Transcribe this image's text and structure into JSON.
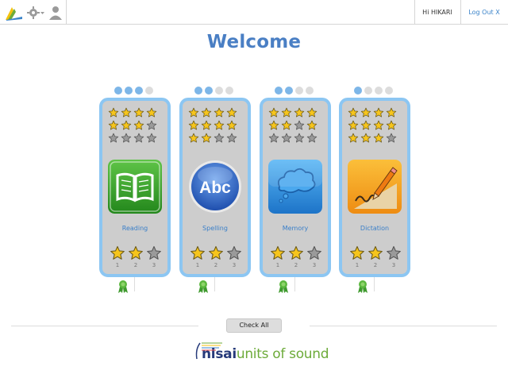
{
  "header": {
    "greeting": "Hi HIKARI",
    "logout_label": "Log Out X"
  },
  "page": {
    "title": "Welcome"
  },
  "units": [
    {
      "label": "Reading",
      "progress_dots_filled": 3,
      "progress_dots_total": 4,
      "star_grid": [
        [
          1,
          1,
          1,
          1
        ],
        [
          1,
          1,
          1,
          0
        ],
        [
          0,
          0,
          0,
          0
        ]
      ],
      "big_stars": [
        1,
        1,
        0
      ],
      "star_numbers": [
        "1",
        "2",
        "3"
      ]
    },
    {
      "label": "Spelling",
      "progress_dots_filled": 2,
      "progress_dots_total": 4,
      "star_grid": [
        [
          1,
          1,
          1,
          1
        ],
        [
          1,
          1,
          1,
          1
        ],
        [
          1,
          1,
          0,
          0
        ]
      ],
      "big_stars": [
        1,
        1,
        0
      ],
      "star_numbers": [
        "1",
        "2",
        "3"
      ]
    },
    {
      "label": "Memory",
      "progress_dots_filled": 2,
      "progress_dots_total": 4,
      "star_grid": [
        [
          1,
          1,
          1,
          1
        ],
        [
          1,
          1,
          0,
          1
        ],
        [
          0,
          0,
          0,
          0
        ]
      ],
      "big_stars": [
        1,
        1,
        0
      ],
      "star_numbers": [
        "1",
        "2",
        "3"
      ]
    },
    {
      "label": "Dictation",
      "progress_dots_filled": 1,
      "progress_dots_total": 4,
      "star_grid": [
        [
          1,
          1,
          1,
          1
        ],
        [
          1,
          1,
          1,
          1
        ],
        [
          1,
          1,
          1,
          0
        ]
      ],
      "big_stars": [
        1,
        1,
        0
      ],
      "star_numbers": [
        "1",
        "2",
        "3"
      ]
    }
  ],
  "actions": {
    "check_all_label": "Check All"
  },
  "brand": {
    "part1": "nisai",
    "part2": "units of sound"
  },
  "colors": {
    "accent_blue": "#4a7fc4",
    "card_border": "#8cc6f2",
    "card_bg": "#cdcdcd",
    "star_gold": "#f6c51c",
    "star_grey": "#9a9a9a",
    "dot_on": "#7db6e8",
    "dot_off": "#dcdcdc"
  },
  "icons": {
    "reading": "open-book-icon",
    "spelling": "abc-icon",
    "memory": "cloud-icon",
    "dictation": "pencil-writing-icon",
    "award": "award-ribbon-icon"
  }
}
